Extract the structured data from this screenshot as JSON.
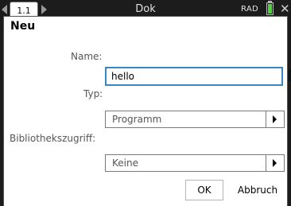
{
  "topbar": {
    "tab_label": "1.1",
    "document_title": "Dok",
    "angle_mode": "RAD",
    "colors": {
      "battery": "#4fd43a",
      "background": "#1c1c1c"
    },
    "icons": [
      "chevron-left-icon",
      "chevron-right-icon",
      "battery-icon",
      "close-icon"
    ]
  },
  "dialog": {
    "title": "Neu",
    "name_label": "Name:",
    "name_value": "hello",
    "type_label": "Typ:",
    "type_value": "Programm",
    "library_label": "Bibliothekszugriff:",
    "library_value": "Keine",
    "ok_label": "OK",
    "cancel_label": "Abbruch",
    "colors": {
      "focus_border": "#3b86c6"
    }
  }
}
